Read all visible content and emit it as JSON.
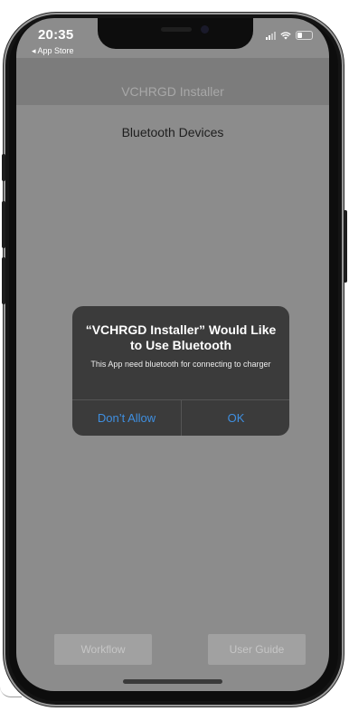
{
  "status_bar": {
    "time": "20:35",
    "back_label": "◂ App Store"
  },
  "navbar": {
    "title": "VCHRGD Installer"
  },
  "main": {
    "section_title": "Bluetooth Devices"
  },
  "buttons": {
    "workflow": "Workflow",
    "user_guide": "User Guide"
  },
  "alert": {
    "title": "“VCHRGD Installer” Would Like to Use Bluetooth",
    "message": "This App need bluetooth for connecting to charger",
    "deny_label": "Don’t Allow",
    "ok_label": "OK"
  },
  "colors": {
    "alert_button": "#3f8fe0",
    "dimmed_background": "#8c8c8c"
  }
}
